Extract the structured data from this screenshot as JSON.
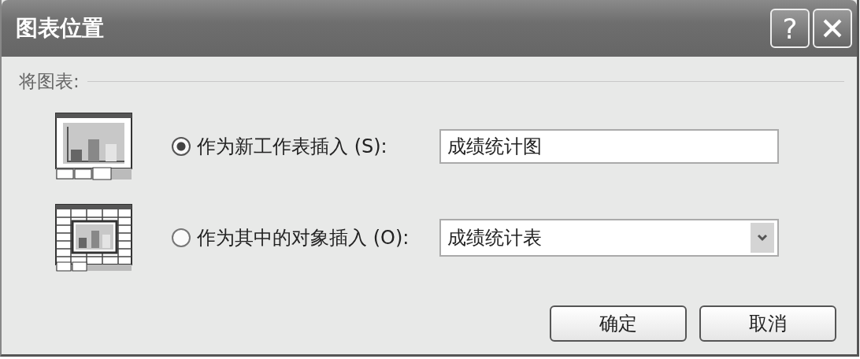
{
  "window": {
    "title": "图表位置",
    "title_buttons": [
      {
        "kind": "help",
        "label": "?"
      },
      {
        "kind": "close"
      }
    ]
  },
  "group": {
    "label": "将图表:"
  },
  "options": [
    {
      "kind": "new_sheet",
      "label": "作为新工作表插入 (S):",
      "selected": true,
      "field": {
        "kind": "text",
        "value": "成绩统计图"
      }
    },
    {
      "kind": "object",
      "label": "作为其中的对象插入 (O):",
      "selected": false,
      "field": {
        "kind": "dropdown",
        "value": "成绩统计表"
      }
    }
  ],
  "buttons": [
    {
      "label": "确定"
    },
    {
      "label": "取消"
    }
  ]
}
